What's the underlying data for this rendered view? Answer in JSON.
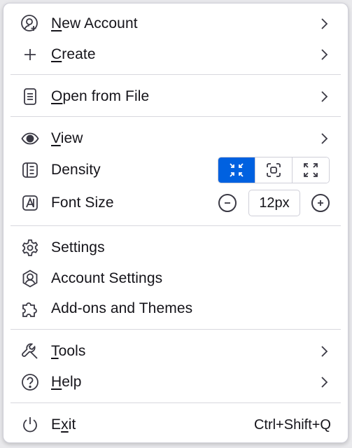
{
  "menu": {
    "new_account": {
      "label_first": "N",
      "label_rest": "ew Account",
      "icon": "new-account-icon"
    },
    "create": {
      "label_first": "C",
      "label_rest": "reate",
      "icon": "plus-icon"
    },
    "open_from_file": {
      "label_first": "O",
      "label_rest": "pen from File",
      "icon": "file-icon"
    },
    "view": {
      "label_first": "V",
      "label_rest": "iew",
      "icon": "eye-icon"
    },
    "density": {
      "label": "Density",
      "icon": "density-icon",
      "options": [
        "compact",
        "default",
        "relaxed"
      ],
      "selected": "compact"
    },
    "font_size": {
      "label": "Font Size",
      "icon": "font-size-icon",
      "value": "12px"
    },
    "settings": {
      "label": "Settings",
      "icon": "gear-icon"
    },
    "account_settings": {
      "label": "Account Settings",
      "icon": "account-settings-icon"
    },
    "addons": {
      "label": "Add-ons and Themes",
      "icon": "puzzle-icon"
    },
    "tools": {
      "label_first": "T",
      "label_rest": "ools",
      "icon": "wrench-icon"
    },
    "help": {
      "label_first": "H",
      "label_rest": "elp",
      "icon": "help-icon"
    },
    "exit": {
      "label_before": "E",
      "label_underlined": "x",
      "label_after": "it",
      "shortcut": "Ctrl+Shift+Q",
      "icon": "power-icon"
    }
  },
  "colors": {
    "accent": "#0061e0",
    "text": "#15141a",
    "separator": "#d8d8de"
  }
}
